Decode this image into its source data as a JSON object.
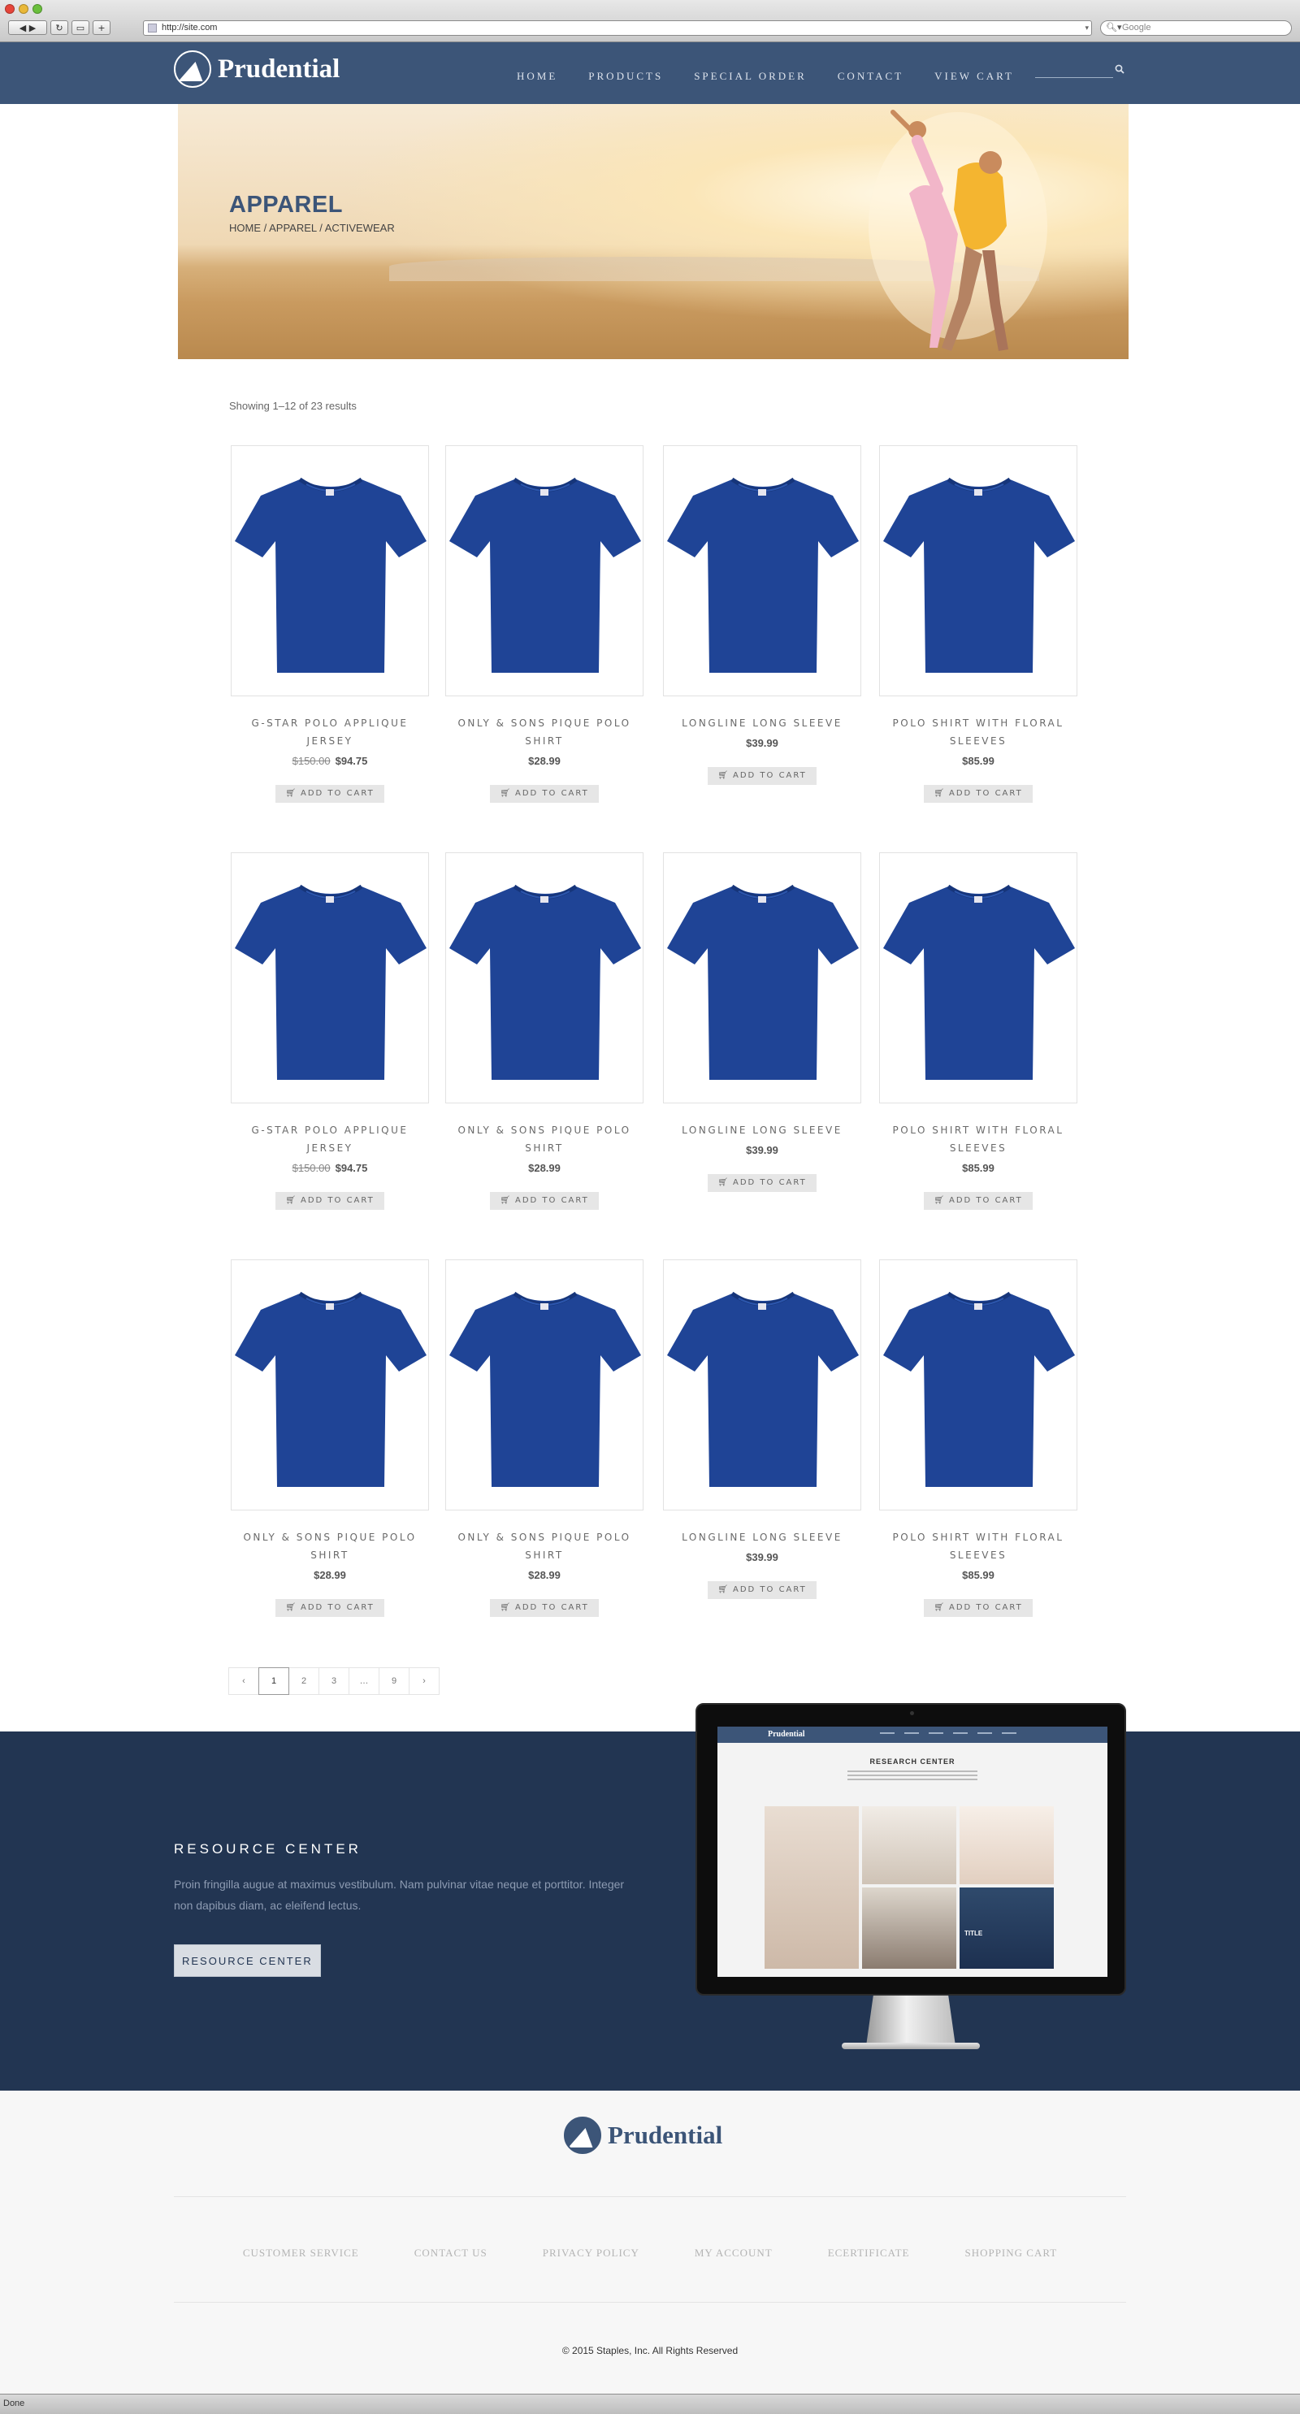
{
  "browser": {
    "url": "http://site.com",
    "search_placeholder": "Google",
    "status": "Done"
  },
  "header": {
    "logo_text": "Prudential",
    "nav": [
      "HOME",
      "PRODUCTS",
      "SPECIAL ORDER",
      "CONTACT",
      "VIEW CART"
    ]
  },
  "hero": {
    "title": "APPAREL",
    "breadcrumb": "HOME / APPAREL / ACTIVEWEAR"
  },
  "results": "Showing 1–12 of 23 results",
  "products": [
    {
      "name": "G-STAR POLO APPLIQUE JERSEY",
      "old_price": "$150.00",
      "price": "$94.75",
      "cart": "ADD TO CART"
    },
    {
      "name": "ONLY & SONS PIQUE POLO SHIRT",
      "old_price": "",
      "price": "$28.99",
      "cart": "ADD TO CART"
    },
    {
      "name": "LONGLINE LONG SLEEVE",
      "old_price": "",
      "price": "$39.99",
      "cart": "ADD TO CART"
    },
    {
      "name": "POLO SHIRT WITH FLORAL SLEEVES",
      "old_price": "",
      "price": "$85.99",
      "cart": "ADD TO CART"
    },
    {
      "name": "G-STAR POLO APPLIQUE JERSEY",
      "old_price": "$150.00",
      "price": "$94.75",
      "cart": "ADD TO CART"
    },
    {
      "name": "ONLY & SONS PIQUE POLO SHIRT",
      "old_price": "",
      "price": "$28.99",
      "cart": "ADD TO CART"
    },
    {
      "name": "LONGLINE LONG SLEEVE",
      "old_price": "",
      "price": "$39.99",
      "cart": "ADD TO CART"
    },
    {
      "name": "POLO SHIRT WITH FLORAL SLEEVES",
      "old_price": "",
      "price": "$85.99",
      "cart": "ADD TO CART"
    },
    {
      "name": "ONLY & SONS PIQUE POLO SHIRT",
      "old_price": "",
      "price": "$28.99",
      "cart": "ADD TO CART"
    },
    {
      "name": "ONLY & SONS PIQUE POLO SHIRT",
      "old_price": "",
      "price": "$28.99",
      "cart": "ADD TO CART"
    },
    {
      "name": "LONGLINE LONG SLEEVE",
      "old_price": "",
      "price": "$39.99",
      "cart": "ADD TO CART"
    },
    {
      "name": "POLO SHIRT WITH FLORAL SLEEVES",
      "old_price": "",
      "price": "$85.99",
      "cart": "ADD TO CART"
    }
  ],
  "pagination": {
    "prev": "‹",
    "pages": [
      "1",
      "2",
      "3",
      "…",
      "9"
    ],
    "next": "›",
    "current": "1"
  },
  "resource": {
    "title": "RESOURCE CENTER",
    "text": "Proin fringilla augue at maximus vestibulum. Nam pulvinar vitae neque et porttitor. Integer non dapibus diam, ac eleifend lectus.",
    "button": "RESOURCE CENTER",
    "screen_title": "RESEARCH CENTER",
    "screen_logo": "Prudential",
    "screen_tile": "TITLE"
  },
  "footer": {
    "logo_text": "Prudential",
    "links": [
      "CUSTOMER SERVICE",
      "CONTACT US",
      "PRIVACY POLICY",
      "MY ACCOUNT",
      "ECERTIFICATE",
      "SHOPPING CART"
    ],
    "copyright": "© 2015 Staples, Inc. All Rights Reserved"
  },
  "colors": {
    "header_bg": "#3c5578",
    "resource_bg": "#223552",
    "shirt_blue": "#1f4496",
    "footer_bg": "#f7f7f7"
  },
  "icons": {
    "cart": "cart-icon",
    "search": "search-icon"
  }
}
